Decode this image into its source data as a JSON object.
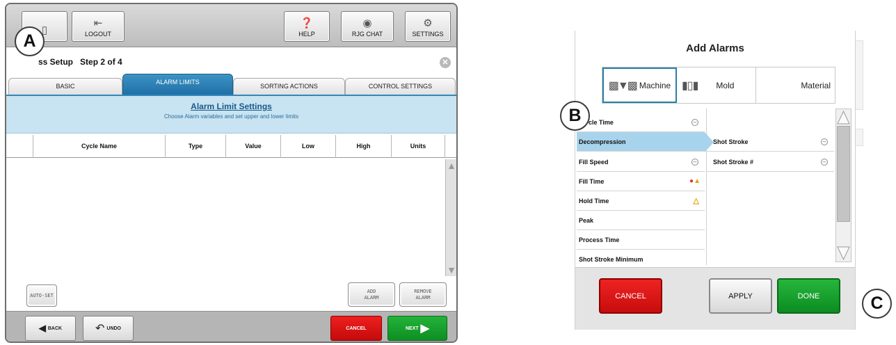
{
  "colors": {
    "accent": "#1f6fa6",
    "banner": "#c8e3f1",
    "cancel": "#d41515",
    "next": "#15a12d",
    "selected_row": "#a8d3ec"
  },
  "markers": {
    "a": "A",
    "b": "B",
    "c": "C"
  },
  "topbar": {
    "logout_label": "LOGOUT",
    "logout_icon": "logout-icon",
    "help_label": "HELP",
    "help_icon": "question-icon",
    "chat_label": "RJG CHAT",
    "chat_icon": "chat-icon",
    "settings_label": "SETTINGS",
    "settings_icon": "gear-icon"
  },
  "setup": {
    "title": "Process Setup",
    "step": "Step 2 of 4",
    "title_visible": "ss Setup",
    "close_icon": "close-icon"
  },
  "tabs": [
    {
      "label": "BASIC",
      "active": false
    },
    {
      "label": "ALARM LIMITS",
      "active": true
    },
    {
      "label": "SORTING ACTIONS",
      "active": false
    },
    {
      "label": "CONTROL SETTINGS",
      "active": false
    }
  ],
  "banner": {
    "title": "Alarm Limit Settings",
    "subtitle": "Choose Alarm variables and set upper and lower limits"
  },
  "table": {
    "columns": [
      "Cycle Name",
      "Type",
      "Value",
      "Low",
      "High",
      "Units"
    ],
    "rows": []
  },
  "buttons": {
    "auto_set": "AUTO-SET",
    "add_alarm_1": "ADD",
    "add_alarm_2": "ALARM",
    "remove_alarm_1": "REMOVE",
    "remove_alarm_2": "ALARM"
  },
  "bottom": {
    "back": "BACK",
    "undo": "UNDO",
    "cancel": "CANCEL",
    "next": "NEXT"
  },
  "dialog": {
    "title": "Add Alarms",
    "segments": [
      {
        "label": "Machine",
        "icon": "machine-icon",
        "active": true
      },
      {
        "label": "Mold",
        "icon": "mold-icon",
        "active": false
      },
      {
        "label": "Material",
        "icon": "",
        "active": false
      }
    ],
    "left_items": [
      {
        "label": "Cycle Time",
        "visible_label": "cle Time",
        "indicator": "minus"
      },
      {
        "label": "Decompression",
        "selected": true
      },
      {
        "label": "Fill Speed",
        "indicator": "minus"
      },
      {
        "label": "Fill Time",
        "indicator": "alarm-warning"
      },
      {
        "label": "Hold Time",
        "indicator": "warning"
      },
      {
        "label": "Peak"
      },
      {
        "label": "Process Time"
      },
      {
        "label": "Shot Stroke Minimum"
      }
    ],
    "right_items": [
      {
        "label": "Shot Stroke",
        "indicator": "minus"
      },
      {
        "label": "Shot Stroke #",
        "indicator": "minus"
      }
    ],
    "footer": {
      "cancel": "CANCEL",
      "apply": "APPLY",
      "done": "DONE"
    }
  }
}
